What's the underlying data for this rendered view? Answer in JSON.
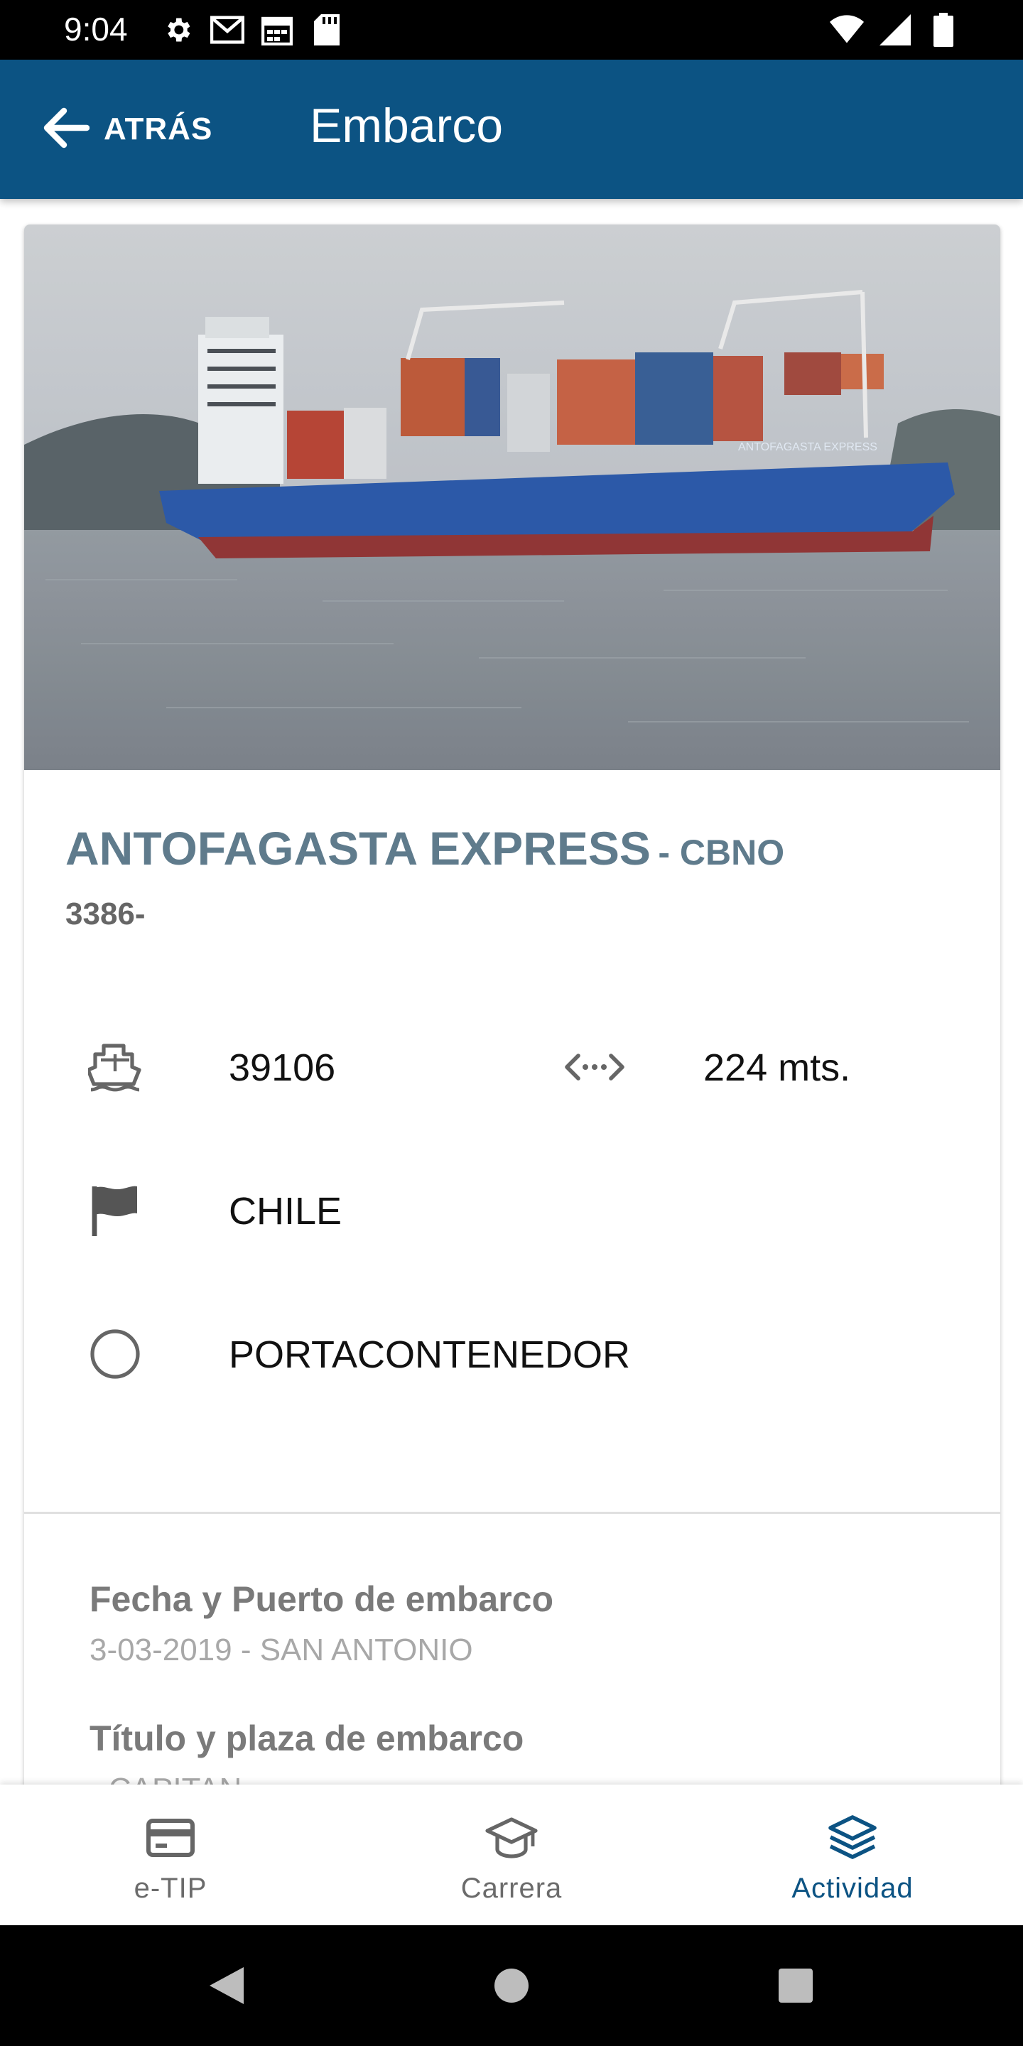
{
  "status_bar": {
    "time": "9:04",
    "left_icons": [
      "settings-icon",
      "gmail-icon",
      "calendar-icon",
      "sd-card-icon"
    ],
    "right_icons": [
      "wifi-icon",
      "signal-icon",
      "battery-icon"
    ]
  },
  "app_bar": {
    "back_label": "ATRÁS",
    "title": "Embarco",
    "color": "#0c5383"
  },
  "vessel": {
    "name": "ANTOFAGASTA EXPRESS",
    "code": "- CBNO",
    "subtitle": "3386-",
    "tonnage": "39106",
    "length": "224 mts.",
    "flag": "CHILE",
    "type": "PORTACONTENEDOR",
    "hull_text": "ANTOFAGASTA EXPRESS"
  },
  "details": [
    {
      "label": "Fecha y Puerto de embarco",
      "value": "3-03-2019 - SAN ANTONIO"
    },
    {
      "label": "Título y plaza de embarco",
      "value": "- CAPITAN"
    }
  ],
  "bottom_nav": {
    "items": [
      {
        "label": "e-TIP",
        "icon": "card-icon",
        "active": false
      },
      {
        "label": "Carrera",
        "icon": "graduation-cap-icon",
        "active": false
      },
      {
        "label": "Actividad",
        "icon": "layers-icon",
        "active": true
      }
    ]
  },
  "system_nav": [
    "back-triangle-icon",
    "home-circle-icon",
    "recents-square-icon"
  ]
}
